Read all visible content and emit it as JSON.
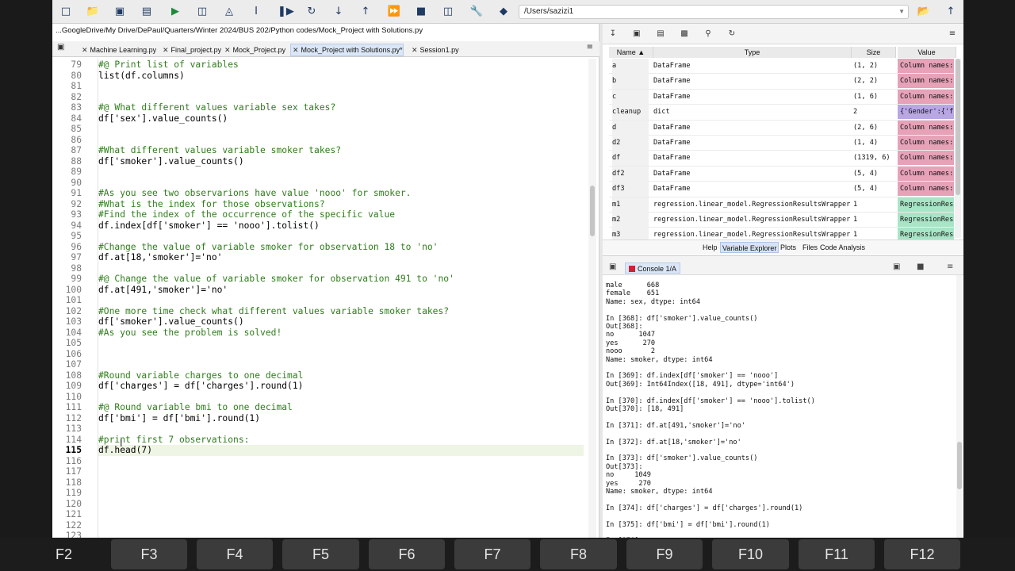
{
  "path_box": "/Users/sazizi1",
  "editor": {
    "file_path": "...GoogleDrive/My Drive/DePaul/Quarters/Winter 2024/BUS 202/Python codes/Mock_Project with Solutions.py",
    "tabs": [
      "Machine Learning.py",
      "Final_project.py",
      "Mock_Project.py",
      "Mock_Project with Solutions.py*",
      "Session1.py"
    ],
    "active_tab": 3,
    "current_line": 115,
    "lines": [
      {
        "n": "79",
        "t": "#@ Print list of variables",
        "c": 1
      },
      {
        "n": "80",
        "t": "list(df.columns)",
        "c": 0
      },
      {
        "n": "81",
        "t": "",
        "c": 0
      },
      {
        "n": "82",
        "t": "",
        "c": 0
      },
      {
        "n": "83",
        "t": "#@ What different values variable sex takes?",
        "c": 1
      },
      {
        "n": "84",
        "t": "df['sex'].value_counts()",
        "c": 0
      },
      {
        "n": "85",
        "t": "",
        "c": 0
      },
      {
        "n": "86",
        "t": "",
        "c": 0
      },
      {
        "n": "87",
        "t": "#What different values variable smoker takes?",
        "c": 1
      },
      {
        "n": "88",
        "t": "df['smoker'].value_counts()",
        "c": 0
      },
      {
        "n": "89",
        "t": "",
        "c": 0
      },
      {
        "n": "90",
        "t": "",
        "c": 0
      },
      {
        "n": "91",
        "t": "#As you see two observarions have value 'nooo' for smoker.",
        "c": 1
      },
      {
        "n": "92",
        "t": "#What is the index for those observations?",
        "c": 1
      },
      {
        "n": "93",
        "t": "#Find the index of the occurrence of the specific value",
        "c": 1
      },
      {
        "n": "94",
        "t": "df.index[df['smoker'] == 'nooo'].tolist()",
        "c": 0
      },
      {
        "n": "95",
        "t": "",
        "c": 0
      },
      {
        "n": "96",
        "t": "#Change the value of variable smoker for observation 18 to 'no'",
        "c": 1
      },
      {
        "n": "97",
        "t": "df.at[18,'smoker']='no'",
        "c": 0
      },
      {
        "n": "98",
        "t": "",
        "c": 0
      },
      {
        "n": "99",
        "t": "#@ Change the value of variable smoker for observation 491 to 'no'",
        "c": 1
      },
      {
        "n": "100",
        "t": "df.at[491,'smoker']='no'",
        "c": 0
      },
      {
        "n": "101",
        "t": "",
        "c": 0
      },
      {
        "n": "102",
        "t": "#One more time check what different values variable smoker takes?",
        "c": 1
      },
      {
        "n": "103",
        "t": "df['smoker'].value_counts()",
        "c": 0
      },
      {
        "n": "104",
        "t": "#As you see the problem is solved!",
        "c": 1
      },
      {
        "n": "105",
        "t": "",
        "c": 0
      },
      {
        "n": "106",
        "t": "",
        "c": 0
      },
      {
        "n": "107",
        "t": "",
        "c": 0
      },
      {
        "n": "108",
        "t": "#Round variable charges to one decimal",
        "c": 1
      },
      {
        "n": "109",
        "t": "df['charges'] = df['charges'].round(1)",
        "c": 0
      },
      {
        "n": "110",
        "t": "",
        "c": 0
      },
      {
        "n": "111",
        "t": "#@ Round variable bmi to one decimal",
        "c": 1
      },
      {
        "n": "112",
        "t": "df['bmi'] = df['bmi'].round(1)",
        "c": 0
      },
      {
        "n": "113",
        "t": "",
        "c": 0
      },
      {
        "n": "114",
        "t": "#print first 7 observations:",
        "c": 1
      },
      {
        "n": "115",
        "t": "df.head(7)",
        "c": 0
      },
      {
        "n": "116",
        "t": "",
        "c": 0
      },
      {
        "n": "117",
        "t": "",
        "c": 0
      },
      {
        "n": "118",
        "t": "",
        "c": 0
      },
      {
        "n": "119",
        "t": "",
        "c": 0
      },
      {
        "n": "120",
        "t": "",
        "c": 0
      },
      {
        "n": "121",
        "t": "",
        "c": 0
      },
      {
        "n": "122",
        "t": "",
        "c": 0
      },
      {
        "n": "123",
        "t": "",
        "c": 0
      }
    ]
  },
  "variable_explorer": {
    "headers": [
      "Name",
      "Type",
      "Size",
      "Value"
    ],
    "rows": [
      {
        "name": "a",
        "type": "DataFrame",
        "size": "(1, 2)",
        "value": "Column names:",
        "kind": "df"
      },
      {
        "name": "b",
        "type": "DataFrame",
        "size": "(2, 2)",
        "value": "Column names:",
        "kind": "df"
      },
      {
        "name": "c",
        "type": "DataFrame",
        "size": "(1, 6)",
        "value": "Column names:",
        "kind": "df"
      },
      {
        "name": "cleanup",
        "type": "dict",
        "size": "2",
        "value": "{'Gender':{'f",
        "kind": "dict"
      },
      {
        "name": "d",
        "type": "DataFrame",
        "size": "(2, 6)",
        "value": "Column names:",
        "kind": "df"
      },
      {
        "name": "d2",
        "type": "DataFrame",
        "size": "(1, 4)",
        "value": "Column names:",
        "kind": "df"
      },
      {
        "name": "df",
        "type": "DataFrame",
        "size": "(1319, 6)",
        "value": "Column names:",
        "kind": "df"
      },
      {
        "name": "df2",
        "type": "DataFrame",
        "size": "(5, 4)",
        "value": "Column names:",
        "kind": "df"
      },
      {
        "name": "df3",
        "type": "DataFrame",
        "size": "(5, 4)",
        "value": "Column names:",
        "kind": "df"
      },
      {
        "name": "m1",
        "type": "regression.linear_model.RegressionResultsWrapper",
        "size": "1",
        "value": "RegressionRes",
        "kind": "reg"
      },
      {
        "name": "m2",
        "type": "regression.linear_model.RegressionResultsWrapper",
        "size": "1",
        "value": "RegressionRes",
        "kind": "reg"
      },
      {
        "name": "m3",
        "type": "regression.linear_model.RegressionResultsWrapper",
        "size": "1",
        "value": "RegressionRes",
        "kind": "reg"
      }
    ],
    "pane_tabs": [
      "Help",
      "Variable Explorer",
      "Plots",
      "Files",
      "Code Analysis"
    ],
    "active_pane_tab": 1
  },
  "console": {
    "tab_label": "Console 1/A",
    "lines": [
      "male      668",
      "female    651",
      "Name: sex, dtype: int64",
      "",
      "In [368]: df['smoker'].value_counts()",
      "Out[368]:",
      "no      1047",
      "yes      270",
      "nooo       2",
      "Name: smoker, dtype: int64",
      "",
      "In [369]: df.index[df['smoker'] == 'nooo']",
      "Out[369]: Int64Index([18, 491], dtype='int64')",
      "",
      "In [370]: df.index[df['smoker'] == 'nooo'].tolist()",
      "Out[370]: [18, 491]",
      "",
      "In [371]: df.at[491,'smoker']='no'",
      "",
      "In [372]: df.at[18,'smoker']='no'",
      "",
      "In [373]: df['smoker'].value_counts()",
      "Out[373]:",
      "no     1049",
      "yes     270",
      "Name: smoker, dtype: int64",
      "",
      "In [374]: df['charges'] = df['charges'].round(1)",
      "",
      "In [375]: df['bmi'] = df['bmi'].round(1)",
      "",
      "In [376]:"
    ]
  },
  "function_keys": [
    "F2",
    "F3",
    "F4",
    "F5",
    "F6",
    "F7",
    "F8",
    "F9",
    "F10",
    "F11",
    "F12"
  ],
  "colors": {
    "dataframe": "#e7a2b8",
    "dict": "#b9a6e4",
    "regression": "#a8e5c6",
    "comment": "#2e7d1a",
    "current_line": "#eef5e4"
  }
}
